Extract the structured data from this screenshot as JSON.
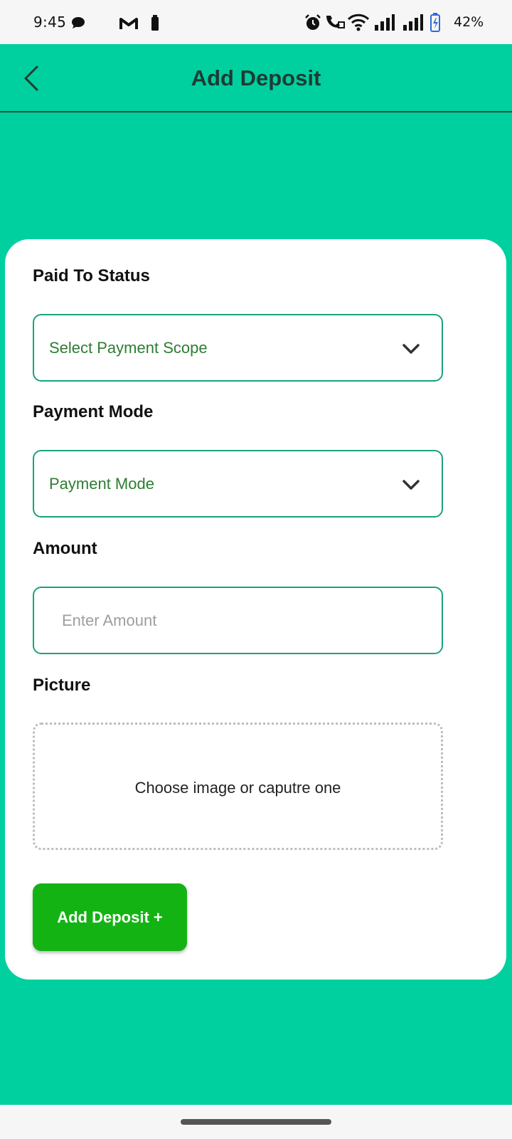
{
  "status_bar": {
    "time": "9:45",
    "battery_percent": "42%",
    "icons": [
      "chat-icon",
      "gmail-icon",
      "battery-small-icon",
      "alarm-icon",
      "wifi-call-icon",
      "wifi-icon",
      "signal-icon",
      "signal-icon",
      "battery-charging-icon"
    ]
  },
  "header": {
    "title": "Add Deposit",
    "back_icon": "chevron-left-icon"
  },
  "form": {
    "paid_to_status": {
      "label": "Paid To Status",
      "selected_value": "Select Payment Scope"
    },
    "payment_mode": {
      "label": "Payment Mode",
      "selected_value": "Payment Mode"
    },
    "amount": {
      "label": "Amount",
      "placeholder": "Enter Amount",
      "value": ""
    },
    "picture": {
      "label": "Picture",
      "upload_text": "Choose image or caputre one"
    },
    "submit_label": "Add Deposit +"
  },
  "colors": {
    "background": "#00CF9F",
    "card": "#FFFFFF",
    "field_border": "#1AA27D",
    "select_text": "#2E7D32",
    "submit_button": "#14B314"
  }
}
